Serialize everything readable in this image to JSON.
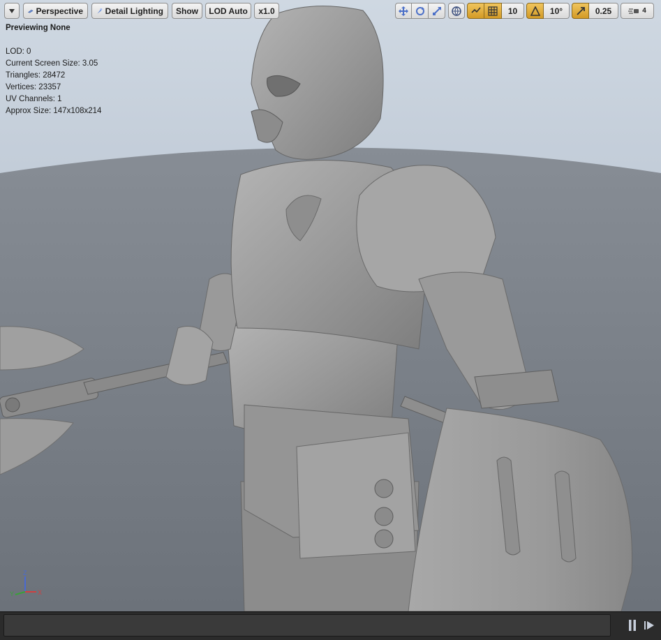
{
  "toolbar": {
    "perspective_label": "Perspective",
    "lighting_label": "Detail Lighting",
    "show_label": "Show",
    "lod_label": "LOD Auto",
    "speed_label": "x1.0",
    "grid_snap_value": "10",
    "rotation_snap_value": "10°",
    "scale_snap_value": "0.25",
    "camera_speed_value": "4"
  },
  "stats": {
    "preview_label": "Previewing None",
    "lines": [
      "LOD: 0",
      "Current Screen Size: 3.05",
      "Triangles: 28472",
      "Vertices: 23357",
      "UV Channels: 1",
      "Approx Size: 147x108x214"
    ]
  },
  "axis": {
    "z": "Z",
    "x": "X",
    "y": "Y"
  },
  "colors": {
    "accent": "#e3ab3a",
    "sky": "#c6d0dc",
    "floor": "#7d838b",
    "mesh": "#9a9a9a"
  }
}
